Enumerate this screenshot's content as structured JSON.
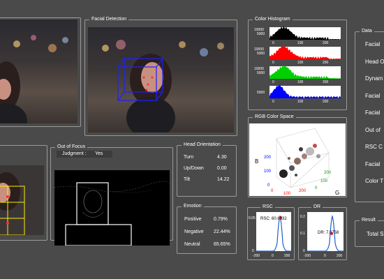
{
  "panels": {
    "facial_detection": "Facial Detection",
    "color_histogram": "Color Histogram",
    "rgb_color_space": "RGB Color Space",
    "out_of_focus": "Out of Focus",
    "head_orientation": "Head Orientation",
    "emotion": "Emotion",
    "rsc": "RSC",
    "dr": "DR",
    "data": "Data",
    "result": "Result"
  },
  "out_of_focus": {
    "judgment_label": "Judgment :",
    "judgment_value": "Yes"
  },
  "head_orientation": {
    "rows": [
      {
        "label": "Turn",
        "value": "4.30"
      },
      {
        "label": "Up/Down",
        "value": "0.00"
      },
      {
        "label": "Tilt",
        "value": "14.22"
      }
    ]
  },
  "emotion": {
    "rows": [
      {
        "label": "Positive",
        "value": "0.79%"
      },
      {
        "label": "Negative",
        "value": "22.44%"
      },
      {
        "label": "Neutral",
        "value": "65.65%"
      }
    ]
  },
  "histogram": {
    "channels": [
      {
        "color": "#000000",
        "ytop": "10000",
        "ymid": "5000"
      },
      {
        "color": "#ff0000",
        "ytop": "10000",
        "ymid": "5000"
      },
      {
        "color": "#00d000",
        "ytop": "10000",
        "ymid": "5000"
      },
      {
        "color": "#0000ff",
        "ytop": "",
        "ymid": "5000"
      }
    ],
    "x_ticks": [
      "0",
      "100",
      "200"
    ]
  },
  "rgb_space": {
    "axis_b": "B",
    "axis_g": "G",
    "b_ticks": [
      "0",
      "100",
      "200"
    ],
    "g_ticks": [
      "0",
      "100",
      "200"
    ],
    "r_ticks": [
      "0",
      "100",
      "200"
    ]
  },
  "rsc": {
    "annotation": "RSC: 60.6532",
    "y_ticks": [
      "0.05",
      "0"
    ],
    "x_ticks": [
      "-200",
      "0",
      "200"
    ]
  },
  "dr": {
    "annotation": "DR: 7.9758",
    "y_ticks": [
      "0.2",
      "0.1",
      "0"
    ],
    "x_ticks": [
      "-200",
      "0",
      "200"
    ]
  },
  "data_items": [
    "Facial",
    "Head O",
    "Dynam",
    "Facial",
    "Facial",
    "Out of",
    "RSC C",
    "Facial",
    "Color T"
  ],
  "result": {
    "label": "Total S"
  },
  "colors": {
    "background": "#4a4a4a",
    "panel_border": "#9a9a9a"
  }
}
